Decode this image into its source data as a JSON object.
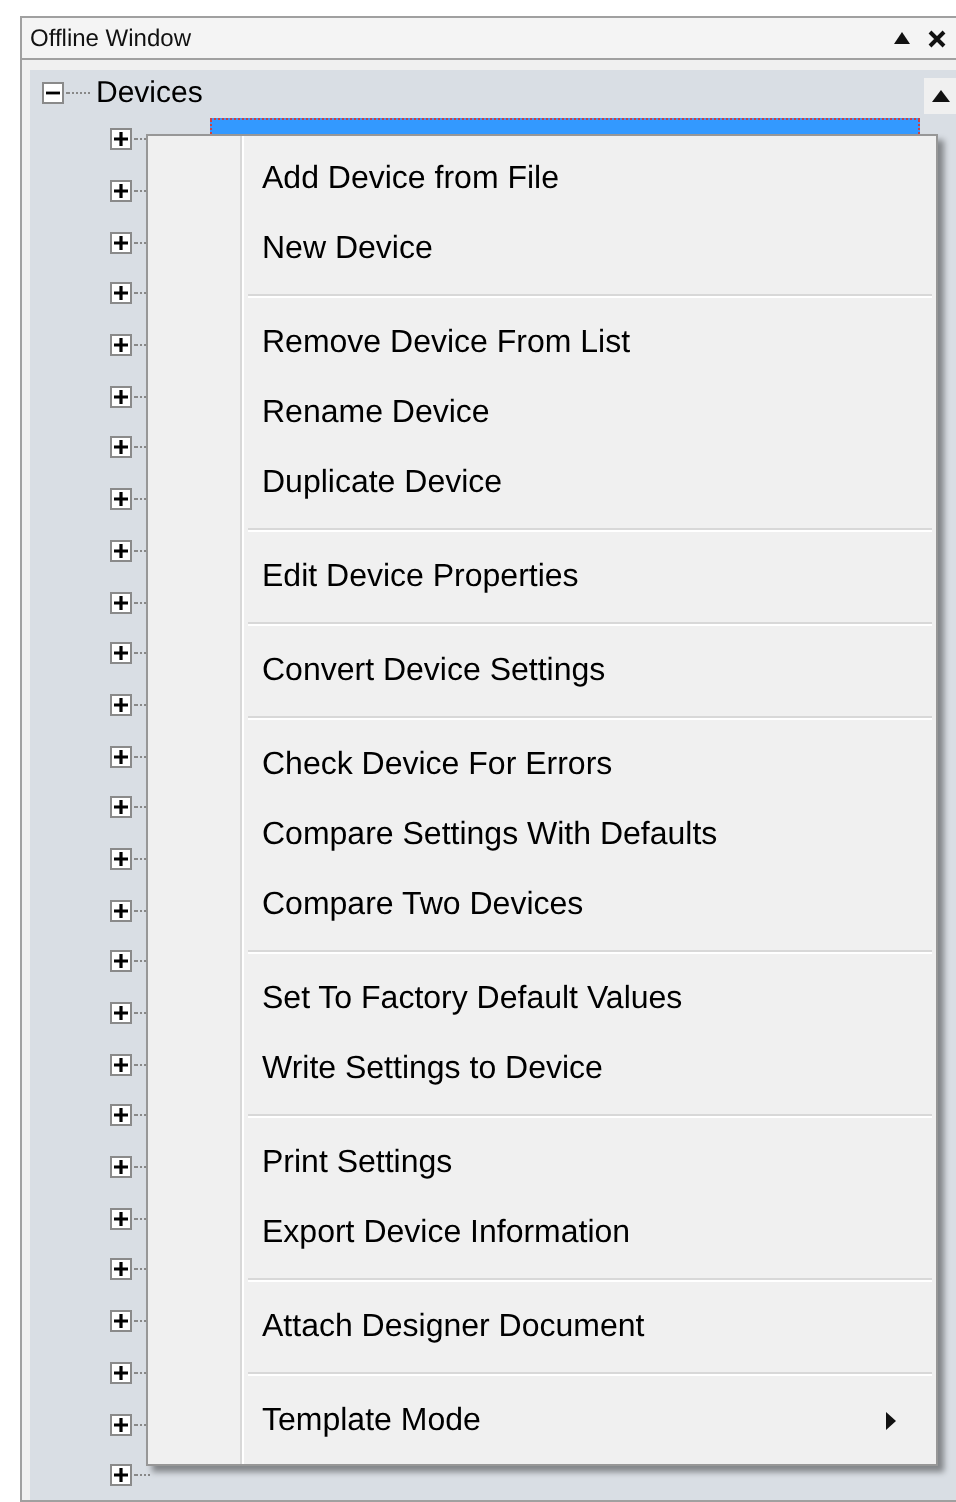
{
  "window": {
    "title": "Offline Window"
  },
  "tree": {
    "root": {
      "label": "Devices",
      "expanded": true
    },
    "children": [
      {
        "selected": true,
        "expanded": false
      },
      {
        "selected": false,
        "expanded": false
      },
      {
        "selected": false,
        "expanded": false
      },
      {
        "selected": false,
        "expanded": false
      },
      {
        "selected": false,
        "expanded": false
      },
      {
        "selected": false,
        "expanded": false
      },
      {
        "selected": false,
        "expanded": false
      },
      {
        "selected": false,
        "expanded": false
      },
      {
        "selected": false,
        "expanded": false
      },
      {
        "selected": false,
        "expanded": false
      },
      {
        "selected": false,
        "expanded": false
      },
      {
        "selected": false,
        "expanded": false
      },
      {
        "selected": false,
        "expanded": false
      },
      {
        "selected": false,
        "expanded": false
      },
      {
        "selected": false,
        "expanded": false
      },
      {
        "selected": false,
        "expanded": false
      },
      {
        "selected": false,
        "expanded": false
      },
      {
        "selected": false,
        "expanded": false
      },
      {
        "selected": false,
        "expanded": false
      },
      {
        "selected": false,
        "expanded": false
      },
      {
        "selected": false,
        "expanded": false
      },
      {
        "selected": false,
        "expanded": false
      },
      {
        "selected": false,
        "expanded": false
      },
      {
        "selected": false,
        "expanded": false
      },
      {
        "selected": false,
        "expanded": false
      },
      {
        "selected": false,
        "expanded": false
      },
      {
        "selected": false,
        "expanded": false
      }
    ]
  },
  "context_menu": {
    "groups": [
      [
        {
          "label": "Add Device from File",
          "has_submenu": false
        },
        {
          "label": "New Device",
          "has_submenu": false
        }
      ],
      [
        {
          "label": "Remove Device From List",
          "has_submenu": false
        },
        {
          "label": "Rename Device",
          "has_submenu": false
        },
        {
          "label": "Duplicate Device",
          "has_submenu": false
        }
      ],
      [
        {
          "label": "Edit Device Properties",
          "has_submenu": false
        }
      ],
      [
        {
          "label": "Convert Device Settings",
          "has_submenu": false
        }
      ],
      [
        {
          "label": "Check Device For Errors",
          "has_submenu": false
        },
        {
          "label": "Compare Settings With Defaults",
          "has_submenu": false
        },
        {
          "label": "Compare Two Devices",
          "has_submenu": false
        }
      ],
      [
        {
          "label": "Set To Factory Default Values",
          "has_submenu": false
        },
        {
          "label": "Write Settings to Device",
          "has_submenu": false
        }
      ],
      [
        {
          "label": "Print Settings",
          "has_submenu": false
        },
        {
          "label": "Export Device Information",
          "has_submenu": false
        }
      ],
      [
        {
          "label": "Attach Designer Document",
          "has_submenu": false
        }
      ],
      [
        {
          "label": "Template Mode",
          "has_submenu": true
        }
      ]
    ]
  }
}
